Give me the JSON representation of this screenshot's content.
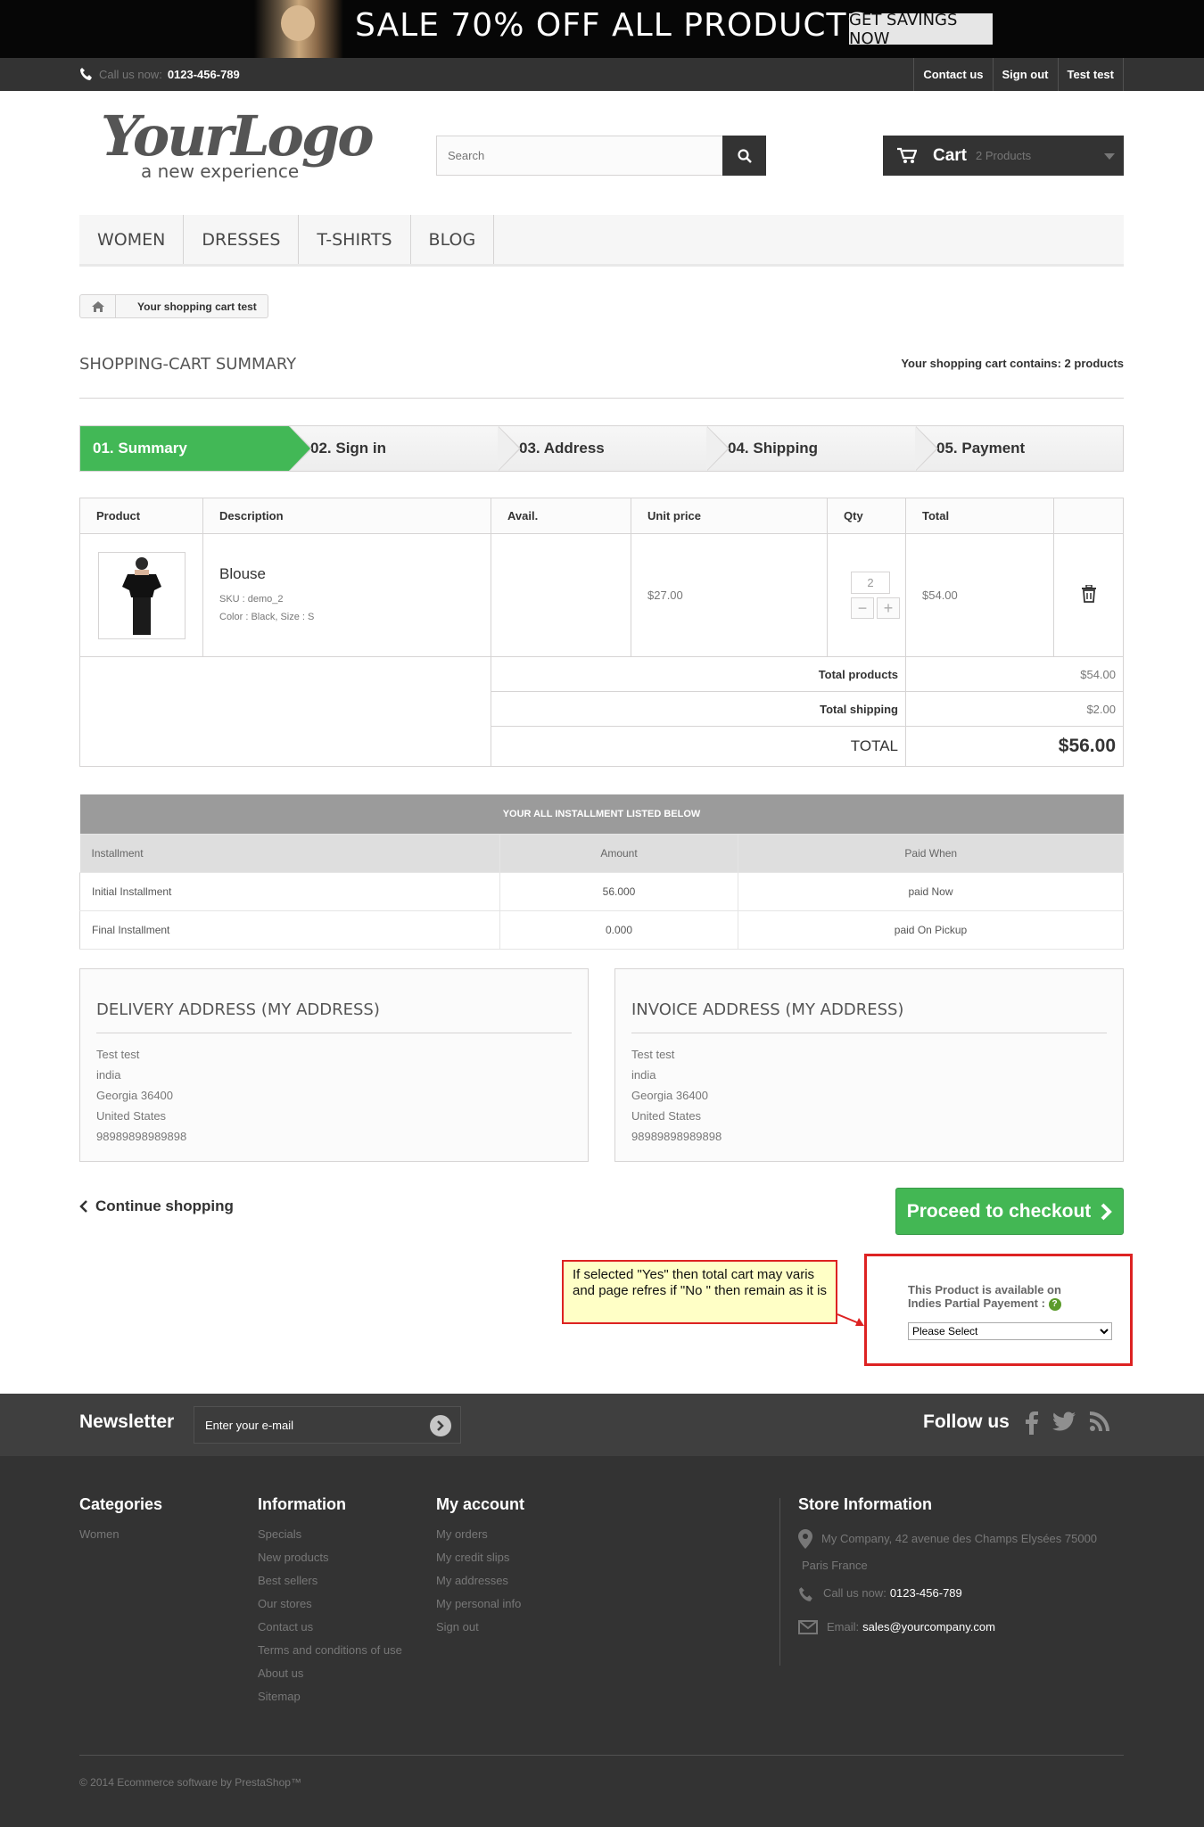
{
  "banner": {
    "sale_text": "SALE 70% OFF ALL PRODUCTS",
    "button": "GET SAVINGS NOW"
  },
  "topbar": {
    "call_label": "Call us now:",
    "phone": "0123-456-789",
    "links": [
      "Contact us",
      "Sign out",
      "Test test"
    ]
  },
  "header": {
    "logo_main": "YourLogo",
    "logo_tagline": "a new experience",
    "search_placeholder": "Search",
    "cart_label": "Cart",
    "cart_count": "2 Products"
  },
  "menu": [
    "WOMEN",
    "DRESSES",
    "T-SHIRTS",
    "BLOG"
  ],
  "breadcrumb": {
    "current": "Your shopping cart test"
  },
  "page": {
    "title": "SHOPPING-CART SUMMARY",
    "cart_contains": "Your shopping cart contains: 2 products"
  },
  "steps": [
    "01. Summary",
    "02. Sign in",
    "03. Address",
    "04. Shipping",
    "05. Payment"
  ],
  "cart_table": {
    "headers": [
      "Product",
      "Description",
      "Avail.",
      "Unit price",
      "Qty",
      "Total"
    ],
    "item": {
      "name": "Blouse",
      "sku": "SKU : demo_2",
      "attrs": "Color : Black, Size : S",
      "unit_price": "$27.00",
      "qty": "2",
      "total": "$54.00"
    },
    "totals": {
      "products_label": "Total products",
      "products_value": "$54.00",
      "shipping_label": "Total shipping",
      "shipping_value": "$2.00",
      "total_label": "TOTAL",
      "total_value": "$56.00"
    }
  },
  "installments": {
    "title": "YOUR ALL INSTALLMENT LISTED BELOW",
    "headers": [
      "Installment",
      "Amount",
      "Paid When"
    ],
    "rows": [
      {
        "name": "Initial Installment",
        "amount": "56.000",
        "when": "paid Now"
      },
      {
        "name": "Final Installment",
        "amount": "0.000",
        "when": "paid On Pickup"
      }
    ]
  },
  "delivery": {
    "title": "DELIVERY ADDRESS (MY ADDRESS)",
    "lines": [
      "Test test",
      "india",
      "Georgia 36400",
      "United States",
      "98989898989898"
    ]
  },
  "invoice": {
    "title": "INVOICE ADDRESS (MY ADDRESS)",
    "lines": [
      "Test test",
      "india",
      "Georgia 36400",
      "United States",
      "98989898989898"
    ]
  },
  "actions": {
    "continue": "Continue shopping",
    "proceed": "Proceed to checkout"
  },
  "annotation": {
    "note": "If selected \"Yes\" then total cart may varis and page refres if \"No \" then remain as it is"
  },
  "partial_payment": {
    "label_line1": "This Product is available on",
    "label_line2": "Indies Partial Payement :",
    "help": "?",
    "select_value": "Please Select"
  },
  "newsletter": {
    "title": "Newsletter",
    "placeholder": "Enter your e-mail",
    "follow": "Follow us"
  },
  "footer": {
    "categories": {
      "title": "Categories",
      "items": [
        "Women"
      ]
    },
    "information": {
      "title": "Information",
      "items": [
        "Specials",
        "New products",
        "Best sellers",
        "Our stores",
        "Contact us",
        "Terms and conditions of use",
        "About us",
        "Sitemap"
      ]
    },
    "my_account": {
      "title": "My account",
      "items": [
        "My orders",
        "My credit slips",
        "My addresses",
        "My personal info",
        "Sign out"
      ]
    },
    "store": {
      "title": "Store Information",
      "address_line1": "My Company, 42 avenue des Champs Elysées 75000",
      "address_line2": "Paris France",
      "call_label": "Call us now:",
      "phone": "0123-456-789",
      "email_label": "Email:",
      "email": "sales@yourcompany.com"
    },
    "copyright": "© 2014 Ecommerce software by PrestaShop™"
  },
  "colors": {
    "accent_green": "#42b856",
    "dark": "#333333",
    "annotation_red": "#dd2222"
  }
}
